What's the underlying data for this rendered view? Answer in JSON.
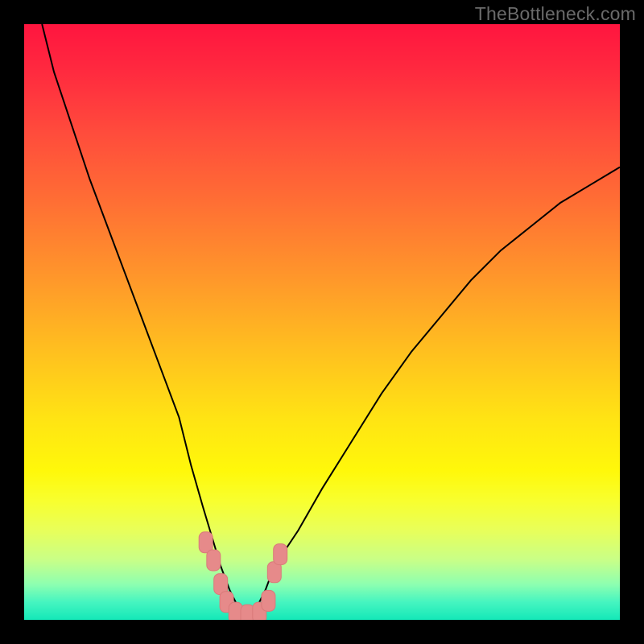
{
  "watermark": "TheBottleneck.com",
  "colors": {
    "curve_stroke": "#000000",
    "marker_fill": "#e68a8a",
    "marker_stroke": "#d97a7a",
    "frame_bg": "#000000"
  },
  "chart_data": {
    "type": "line",
    "title": "",
    "xlabel": "",
    "ylabel": "",
    "xlim": [
      0,
      100
    ],
    "ylim": [
      0,
      100
    ],
    "grid": false,
    "legend": false,
    "annotations": [],
    "series": [
      {
        "name": "bottleneck-curve",
        "stroke": "#000000",
        "x": [
          3,
          5,
          8,
          11,
          14,
          17,
          20,
          23,
          26,
          28,
          30,
          31.5,
          33,
          34.5,
          36,
          37.5,
          39,
          40.5,
          42,
          46,
          50,
          55,
          60,
          65,
          70,
          75,
          80,
          85,
          90,
          95,
          100
        ],
        "y": [
          100,
          92,
          83,
          74,
          66,
          58,
          50,
          42,
          34,
          26,
          19,
          14,
          9,
          5,
          2,
          1,
          2,
          5,
          9,
          15,
          22,
          30,
          38,
          45,
          51,
          57,
          62,
          66,
          70,
          73,
          76
        ]
      }
    ],
    "markers": {
      "name": "bottom-cluster",
      "fill": "#e68a8a",
      "shape": "rounded-rect",
      "points": [
        {
          "x": 30.5,
          "y": 13
        },
        {
          "x": 31.8,
          "y": 10
        },
        {
          "x": 33.0,
          "y": 6
        },
        {
          "x": 34.0,
          "y": 3
        },
        {
          "x": 35.5,
          "y": 1.2
        },
        {
          "x": 37.5,
          "y": 0.8
        },
        {
          "x": 39.5,
          "y": 1.2
        },
        {
          "x": 41.0,
          "y": 3.2
        },
        {
          "x": 42.0,
          "y": 8
        },
        {
          "x": 43.0,
          "y": 11
        }
      ]
    }
  }
}
